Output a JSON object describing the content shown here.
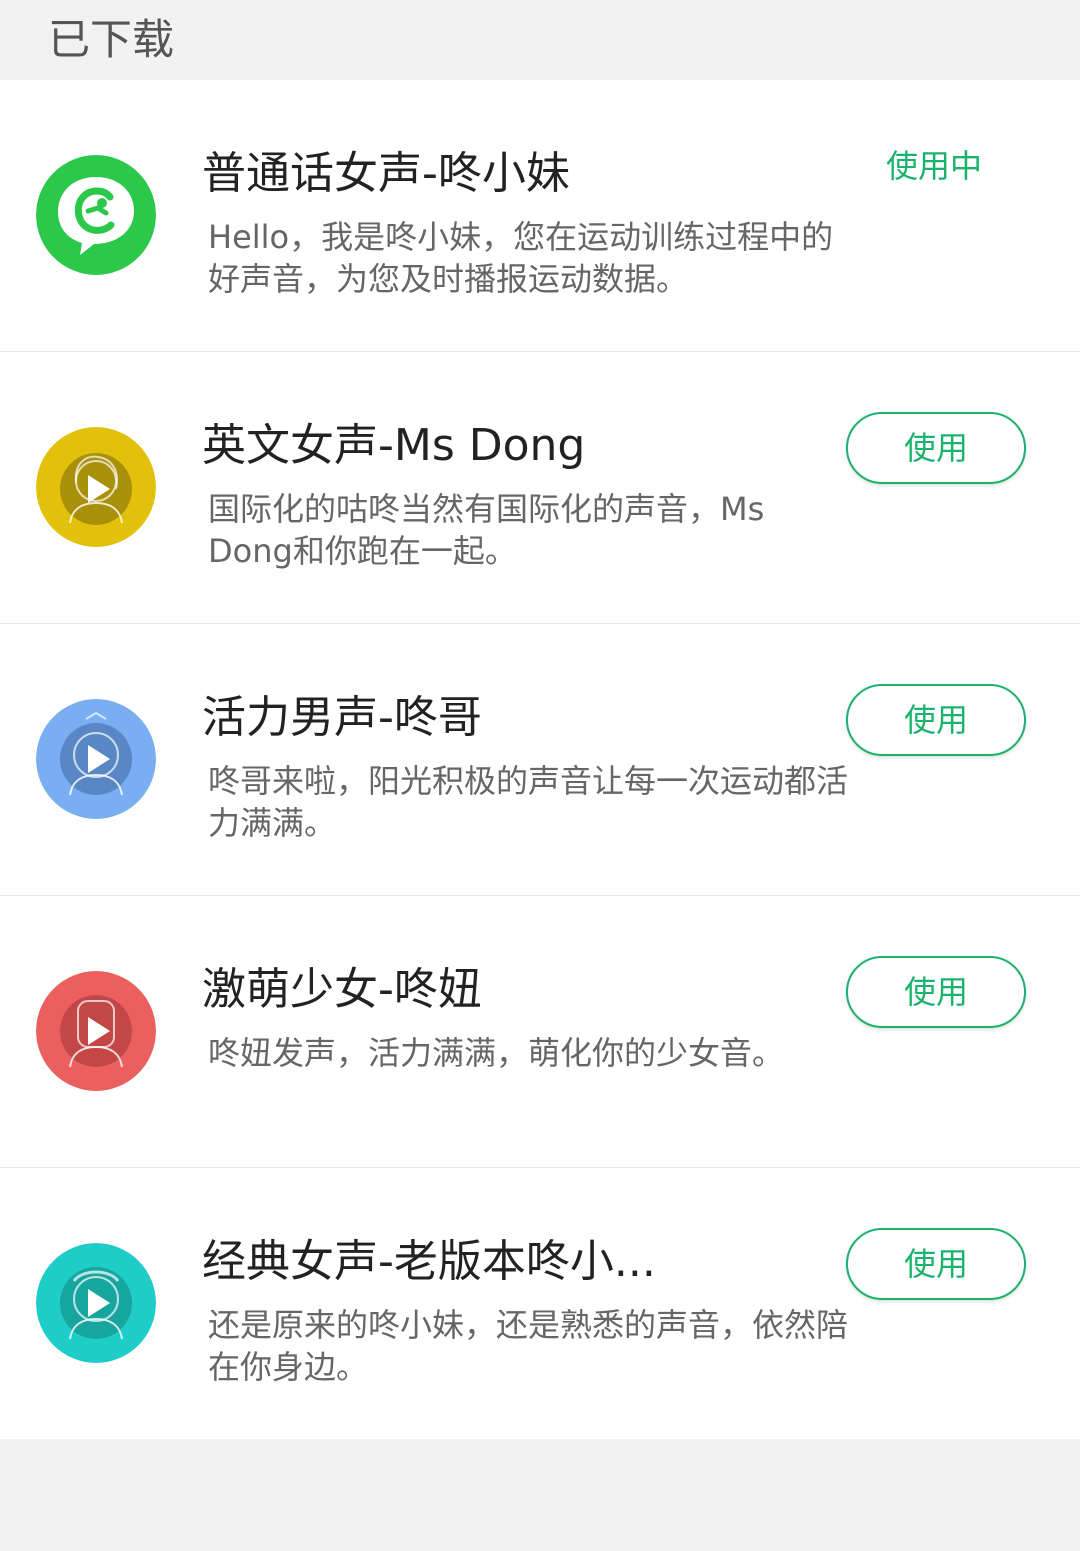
{
  "section": {
    "title": "已下载"
  },
  "items": [
    {
      "title": "普通话女声-咚小妹",
      "desc": "Hello，我是咚小妹，您在运动训练过程中的好声音，为您及时播报运动数据。",
      "status": "使用中",
      "icon": "codoon-logo-icon",
      "color": "#2bc84a"
    },
    {
      "title": "英文女声-Ms Dong",
      "desc": "国际化的咕咚当然有国际化的声音，Ms Dong和你跑在一起。",
      "button": "使用",
      "icon": "play-icon",
      "color": "#e2c10c"
    },
    {
      "title": "活力男声-咚哥",
      "desc": "咚哥来啦，阳光积极的声音让每一次运动都活力满满。",
      "button": "使用",
      "icon": "play-icon",
      "color": "#7aaef2"
    },
    {
      "title": "激萌少女-咚妞",
      "desc": "咚妞发声，活力满满，萌化你的少女音。",
      "button": "使用",
      "icon": "play-icon",
      "color": "#ec5f5f"
    },
    {
      "title": "经典女声-老版本咚小...",
      "desc": "还是原来的咚小妹，还是熟悉的声音，依然陪在你身边。",
      "button": "使用",
      "icon": "play-icon",
      "color": "#1ecdc7"
    }
  ],
  "colors": {
    "accent": "#19b36b",
    "background": "#f2f2f2"
  }
}
